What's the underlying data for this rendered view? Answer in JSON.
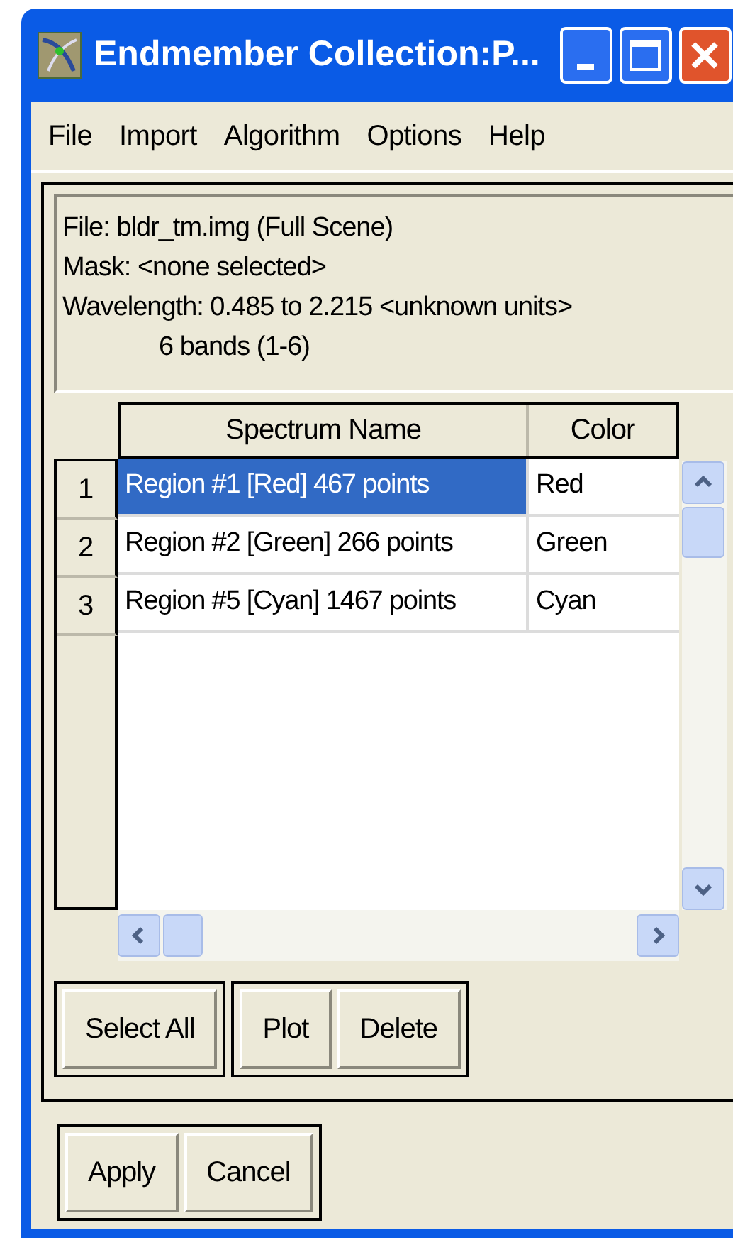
{
  "window": {
    "title": "Endmember Collection:P..."
  },
  "menu": [
    "File",
    "Import",
    "Algorithm",
    "Options",
    "Help"
  ],
  "info": [
    "File: bldr_tm.img (Full Scene)",
    "Mask: <none selected>",
    "Wavelength: 0.485 to 2.215 <unknown units>",
    "6 bands (1-6)"
  ],
  "table": {
    "columns": [
      "Spectrum Name",
      "Color"
    ],
    "rows": [
      {
        "number": "1",
        "name": "Region #1 [Red] 467 points",
        "color_name": "Red",
        "selected": true
      },
      {
        "number": "2",
        "name": "Region #2 [Green] 266 points",
        "color_name": "Green",
        "selected": false
      },
      {
        "number": "3",
        "name": "Region #5 [Cyan] 1467 points",
        "color_name": "Cyan",
        "selected": false
      }
    ]
  },
  "button_groups": [
    [
      "Select All"
    ],
    [
      "Plot",
      "Delete"
    ]
  ],
  "footer_buttons": [
    "Apply",
    "Cancel"
  ]
}
